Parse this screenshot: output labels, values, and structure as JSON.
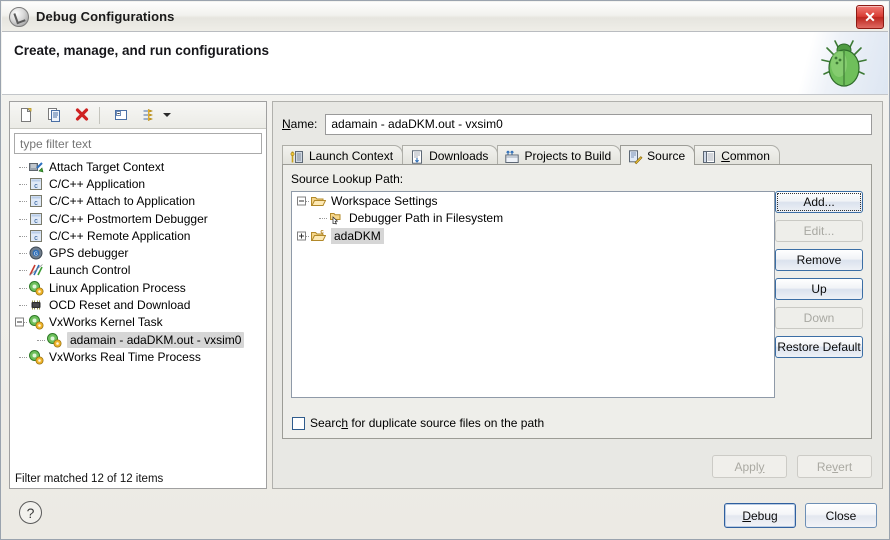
{
  "window": {
    "title": "Debug Configurations",
    "title_icon": "debug-window-icon",
    "close_label": "✕"
  },
  "header": {
    "title": "Create, manage, and run configurations",
    "art_icon": "green-bug-icon"
  },
  "left": {
    "toolbar": [
      {
        "name": "new-configuration-icon",
        "label": "New"
      },
      {
        "name": "duplicate-configuration-icon",
        "label": "Duplicate"
      },
      {
        "name": "delete-configuration-icon",
        "label": "Delete"
      },
      {
        "name": "collapse-all-icon",
        "label": "Collapse All"
      },
      {
        "name": "filter-icon",
        "label": "Filter"
      }
    ],
    "filter": {
      "placeholder": "type filter text",
      "value": ""
    },
    "tree": [
      {
        "label": "Attach Target Context",
        "icon": "attach-target-icon",
        "indent": 0,
        "expander": "none",
        "selected": false
      },
      {
        "label": "C/C++ Application",
        "icon": "c-app-icon",
        "indent": 0,
        "expander": "none",
        "selected": false
      },
      {
        "label": "C/C++ Attach to Application",
        "icon": "c-app-icon",
        "indent": 0,
        "expander": "none",
        "selected": false
      },
      {
        "label": "C/C++ Postmortem Debugger",
        "icon": "c-app-icon",
        "indent": 0,
        "expander": "none",
        "selected": false
      },
      {
        "label": "C/C++ Remote Application",
        "icon": "c-app-icon",
        "indent": 0,
        "expander": "none",
        "selected": false
      },
      {
        "label": "GPS debugger",
        "icon": "gps-debugger-icon",
        "indent": 0,
        "expander": "none",
        "selected": false
      },
      {
        "label": "Launch Control",
        "icon": "launch-control-icon",
        "indent": 0,
        "expander": "none",
        "selected": false
      },
      {
        "label": "Linux Application Process",
        "icon": "process-icon",
        "indent": 0,
        "expander": "none",
        "selected": false
      },
      {
        "label": "OCD Reset and Download",
        "icon": "chip-icon",
        "indent": 0,
        "expander": "none",
        "selected": false
      },
      {
        "label": "VxWorks Kernel Task",
        "icon": "process-icon",
        "indent": 0,
        "expander": "minus",
        "selected": false
      },
      {
        "label": "adamain - adaDKM.out - vxsim0",
        "icon": "process-icon",
        "indent": 1,
        "expander": "none",
        "selected": true
      },
      {
        "label": "VxWorks Real Time Process",
        "icon": "process-icon",
        "indent": 0,
        "expander": "none",
        "selected": false
      }
    ],
    "status": "Filter matched 12 of 12 items"
  },
  "right": {
    "name_label": "Name:",
    "name_value": "adamain - adaDKM.out - vxsim0",
    "tabs": [
      {
        "label": "Launch Context",
        "icon": "launch-context-icon",
        "active": false
      },
      {
        "label": "Downloads",
        "icon": "downloads-icon",
        "active": false
      },
      {
        "label": "Projects to Build",
        "icon": "projects-to-build-icon",
        "active": false
      },
      {
        "label": "Source",
        "icon": "source-icon",
        "active": true
      },
      {
        "label": "Common",
        "icon": "common-icon",
        "active": false
      }
    ],
    "source": {
      "lookup_label": "Source Lookup Path:",
      "entries": [
        {
          "label": "Workspace Settings",
          "icon": "folder-open-icon",
          "indent": 0,
          "expander": "minus",
          "selected": false
        },
        {
          "label": "Debugger Path in Filesystem",
          "icon": "debugger-path-icon",
          "indent": 1,
          "expander": "none",
          "selected": false
        },
        {
          "label": "adaDKM",
          "icon": "c-project-folder-icon",
          "indent": 0,
          "expander": "plus",
          "selected": true
        }
      ],
      "buttons": [
        {
          "label": "Add...",
          "state": "focused"
        },
        {
          "label": "Edit...",
          "state": "disabled"
        },
        {
          "label": "Remove",
          "state": "enabled"
        },
        {
          "label": "Up",
          "state": "enabled"
        },
        {
          "label": "Down",
          "state": "disabled"
        },
        {
          "label": "Restore Default",
          "state": "enabled"
        }
      ],
      "duplicate_checkbox": {
        "label_pre": "Searc",
        "label_mnemonic": "h",
        "label_post": " for duplicate source files on the path",
        "checked": false
      }
    },
    "apply_revert": [
      {
        "label_pre": "Appl",
        "label_mnemonic": "y",
        "label_post": "",
        "state": "disabled"
      },
      {
        "label_pre": "Re",
        "label_mnemonic": "v",
        "label_post": "ert",
        "state": "disabled"
      }
    ]
  },
  "footer": {
    "help_icon": "help-question-icon",
    "help_glyph": "?",
    "buttons": [
      {
        "label_pre": "",
        "label_mnemonic": "D",
        "label_post": "ebug",
        "default": true
      },
      {
        "label_pre": "Close",
        "label_mnemonic": "",
        "label_post": "",
        "default": false
      }
    ]
  }
}
